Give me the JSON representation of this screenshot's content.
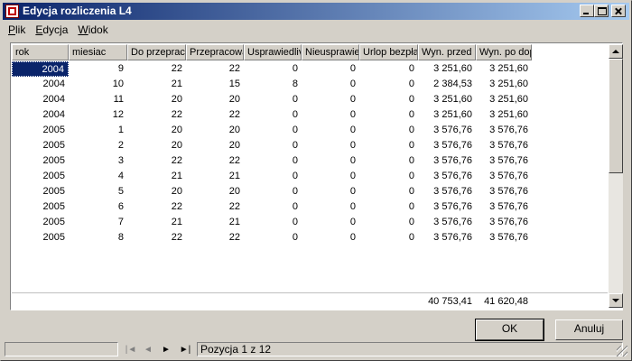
{
  "window": {
    "title": "Edycja rozliczenia L4"
  },
  "menu": [
    {
      "label": "Plik"
    },
    {
      "label": "Edycja"
    },
    {
      "label": "Widok"
    }
  ],
  "grid": {
    "columns": [
      "rok",
      "miesiac",
      "Do przeprac",
      "Przepracowa",
      "Usprawiedliv",
      "Nieusprawie",
      "Urlop bezpła",
      "Wyn. przed r",
      "Wyn. po dop"
    ],
    "rows": [
      [
        "2004",
        "9",
        "22",
        "22",
        "0",
        "0",
        "0",
        "3 251,60",
        "3 251,60"
      ],
      [
        "2004",
        "10",
        "21",
        "15",
        "8",
        "0",
        "0",
        "2 384,53",
        "3 251,60"
      ],
      [
        "2004",
        "11",
        "20",
        "20",
        "0",
        "0",
        "0",
        "3 251,60",
        "3 251,60"
      ],
      [
        "2004",
        "12",
        "22",
        "22",
        "0",
        "0",
        "0",
        "3 251,60",
        "3 251,60"
      ],
      [
        "2005",
        "1",
        "20",
        "20",
        "0",
        "0",
        "0",
        "3 576,76",
        "3 576,76"
      ],
      [
        "2005",
        "2",
        "20",
        "20",
        "0",
        "0",
        "0",
        "3 576,76",
        "3 576,76"
      ],
      [
        "2005",
        "3",
        "22",
        "22",
        "0",
        "0",
        "0",
        "3 576,76",
        "3 576,76"
      ],
      [
        "2005",
        "4",
        "21",
        "21",
        "0",
        "0",
        "0",
        "3 576,76",
        "3 576,76"
      ],
      [
        "2005",
        "5",
        "20",
        "20",
        "0",
        "0",
        "0",
        "3 576,76",
        "3 576,76"
      ],
      [
        "2005",
        "6",
        "22",
        "22",
        "0",
        "0",
        "0",
        "3 576,76",
        "3 576,76"
      ],
      [
        "2005",
        "7",
        "21",
        "21",
        "0",
        "0",
        "0",
        "3 576,76",
        "3 576,76"
      ],
      [
        "2005",
        "8",
        "22",
        "22",
        "0",
        "0",
        "0",
        "3 576,76",
        "3 576,76"
      ]
    ],
    "totals": {
      "before": "40 753,41",
      "after": "41 620,48"
    },
    "selected_row": 0
  },
  "buttons": {
    "ok": "OK",
    "cancel": "Anuluj"
  },
  "status": {
    "position": "Pozycja 1 z 12"
  }
}
